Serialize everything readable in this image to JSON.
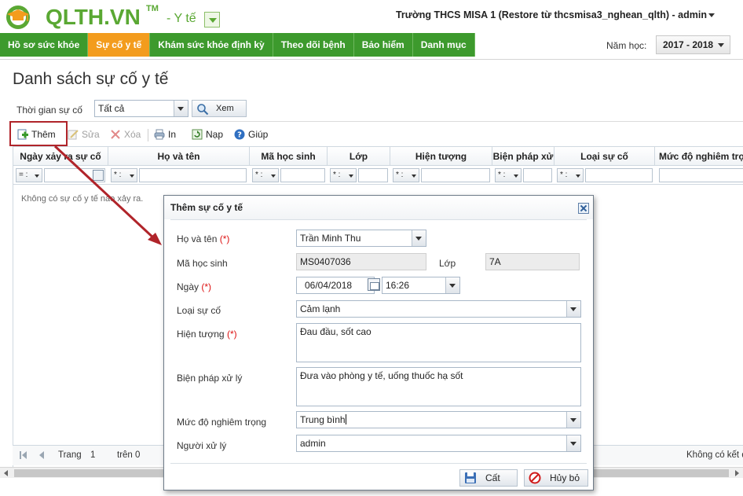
{
  "app": {
    "brand": "QLTH.VN",
    "brand_tm": "TM",
    "module": "- Y tế",
    "school_user": "Trường THCS MISA 1 (Restore từ thcsmisa3_nghean_qlth) - admin"
  },
  "nav": {
    "tabs": [
      {
        "label": "Hồ sơ sức khỏe",
        "active": false
      },
      {
        "label": "Sự cố y tế",
        "active": true
      },
      {
        "label": "Khám sức khỏe định kỳ",
        "active": false
      },
      {
        "label": "Theo dõi bệnh",
        "active": false
      },
      {
        "label": "Bảo hiểm",
        "active": false
      },
      {
        "label": "Danh mục",
        "active": false
      }
    ],
    "year_label": "Năm học:",
    "year_value": "2017 - 2018"
  },
  "main": {
    "title": "Danh sách sự cố y tế",
    "filter_label": "Thời gian sự cố",
    "filter_value": "Tất cả",
    "view_label": "Xem",
    "toolbar": {
      "add": "Thêm",
      "edit": "Sửa",
      "delete": "Xóa",
      "print": "In",
      "load": "Nạp",
      "help": "Giúp"
    },
    "columns": [
      "Ngày xảy ra sự cố",
      "Họ và tên",
      "Mã học sinh",
      "Lớp",
      "Hiện tượng",
      "Biện pháp xử",
      "Loại sự cố",
      "Mức độ nghiêm trọ"
    ],
    "filter_ops": [
      "= :",
      "* :",
      "* :",
      "* :",
      "* :",
      "* :",
      "* :"
    ],
    "empty_message": "Không có sự cố y tế nào xảy ra.",
    "pager": {
      "page_label": "Trang",
      "page_value": "1",
      "of_label": "trên 0",
      "no_result": "Không có kết q"
    }
  },
  "colors": {
    "nav_green": "#3d9a2d",
    "nav_active": "#f39c1d",
    "brand_green": "#5aa833",
    "highlight_red": "#b0242a"
  },
  "dialog": {
    "title": "Thêm sự cố y tế",
    "required_mark": "(*)",
    "labels": {
      "name": "Họ và tên",
      "student_code": "Mã học sinh",
      "class": "Lớp",
      "date": "Ngày",
      "incident_type": "Loại sự cố",
      "symptom": "Hiện tượng",
      "treatment": "Biện pháp xử lý",
      "severity": "Mức độ nghiêm trọng",
      "handler": "Người xử lý"
    },
    "values": {
      "name": "Trần Minh Thu",
      "student_code": "MS0407036",
      "class": "7A",
      "date": "06/04/2018",
      "time": "16:26",
      "incident_type": "Cảm lạnh",
      "symptom": "Đau đầu, sốt cao",
      "treatment": "Đưa vào phòng y tế, uống thuốc hạ sốt",
      "severity": "Trung bình",
      "handler": "admin"
    },
    "buttons": {
      "save": "Cất",
      "cancel": "Hủy bỏ"
    }
  }
}
